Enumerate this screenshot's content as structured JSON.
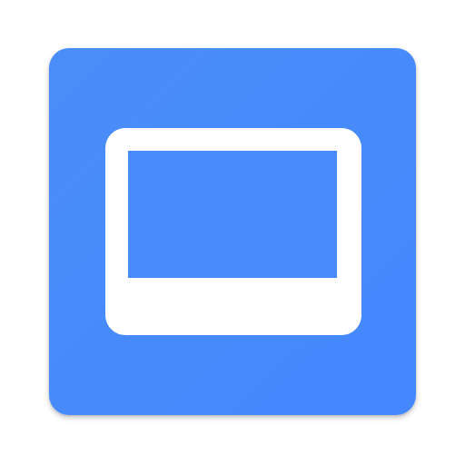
{
  "app_icon": {
    "icon": "monitor-icon",
    "background_color": "#4488ff",
    "glyph_color": "#ffffff"
  }
}
